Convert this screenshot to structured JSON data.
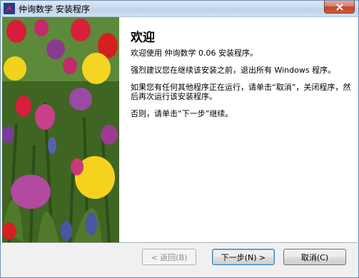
{
  "window": {
    "title": "仲询数学 安装程序"
  },
  "welcome": {
    "heading": "欢迎",
    "p1": "欢迎使用 仲询数学 0.06 安装程序。",
    "p2": "强烈建议您在继续该安装之前，退出所有 Windows 程序。",
    "p3": "如果您有任何其他程序正在运行，请单击“取消”，关闭程序，然后再次运行该安装程序。",
    "p4": "否则，请单击“下一步”继续。"
  },
  "buttons": {
    "back": "< 返回(B)",
    "next": "下一步(N) >",
    "cancel": "取消(C)"
  },
  "colors": {
    "title_bar": "#c7d8ec",
    "close": "#c2462d",
    "accent": "#3c7fb1"
  }
}
